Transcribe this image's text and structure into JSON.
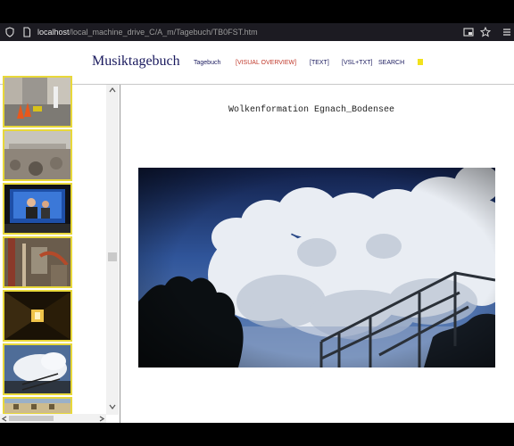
{
  "browser": {
    "url_host": "localhost",
    "url_path": "/local_machine_drive_C/A_m/Tagebuch/TB0FST.htm"
  },
  "header": {
    "brand": "Musiktagebuch",
    "nav": [
      {
        "label": "Tagebuch",
        "color": "#1a1a5e"
      },
      {
        "label": "[VISUAL OVERVIEW]",
        "color": "#c0392b"
      },
      {
        "label": "[TEXT]",
        "color": "#1a1a5e"
      },
      {
        "label": "[VSL+TXT]",
        "color": "#1a1a5e"
      },
      {
        "label": "SEARCH",
        "color": "#1a1a5e"
      }
    ],
    "dot_color": "#f2e21c"
  },
  "content": {
    "title": "Wolkenformation Egnach_Bodensee"
  },
  "colors": {
    "thumb_border": "#e8d83a",
    "url_bar": "#1c1b22"
  }
}
